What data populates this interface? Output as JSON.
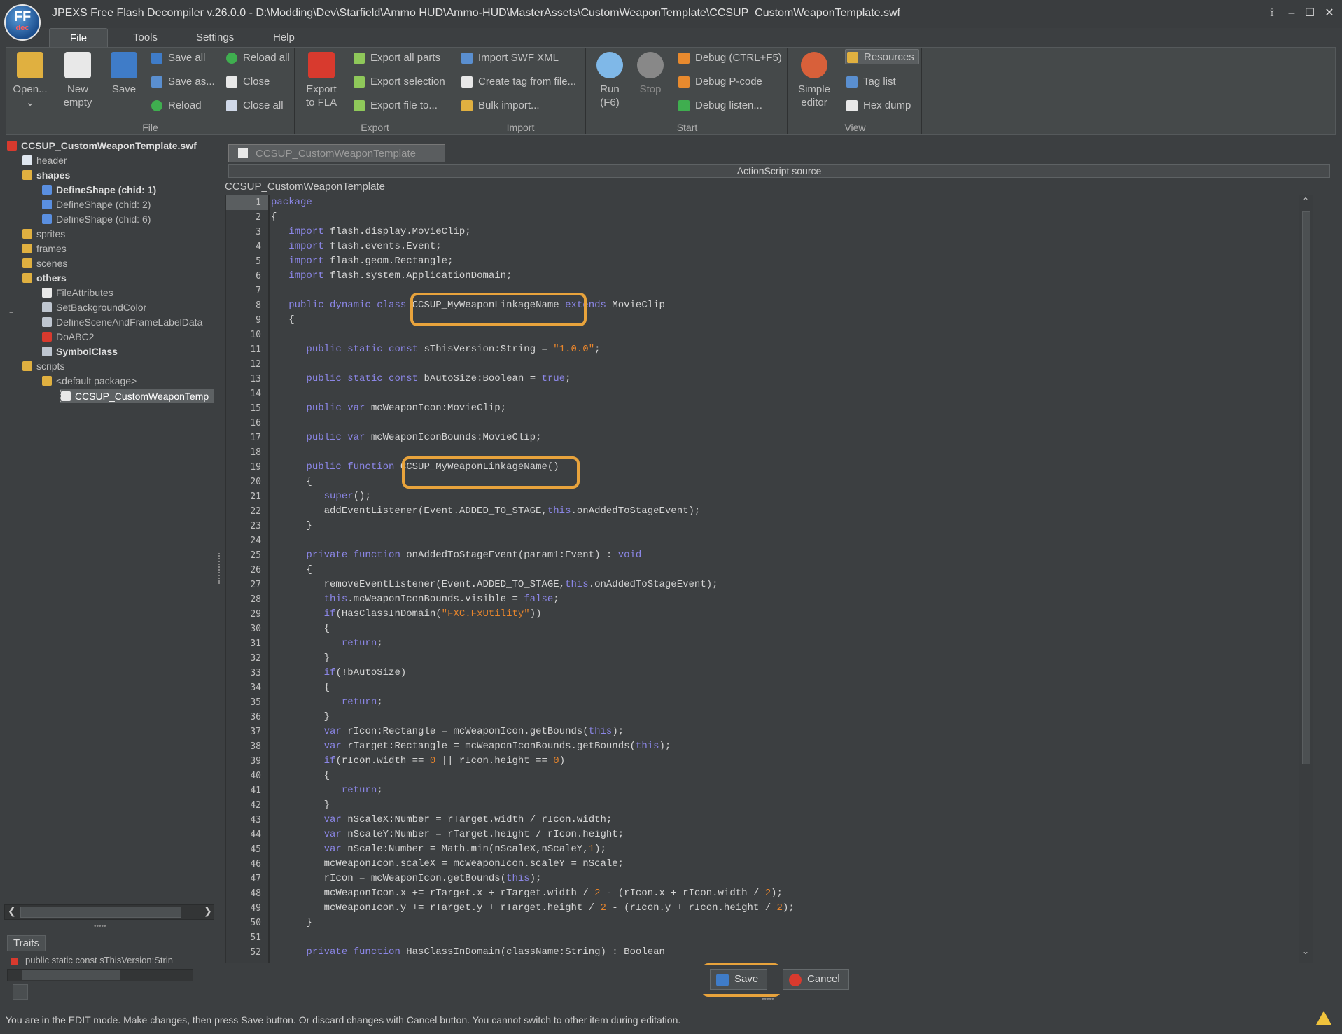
{
  "window": {
    "title": "JPEXS Free Flash Decompiler v.26.0.0 - D:\\Modding\\Dev\\Starfield\\Ammo HUD\\Ammo-HUD\\MasterAssets\\CustomWeaponTemplate\\CCSUP_CustomWeaponTemplate.swf",
    "logo_text": "FF",
    "logo_sub": "dec"
  },
  "menu": {
    "tabs": [
      "File",
      "Tools",
      "Settings",
      "Help"
    ]
  },
  "ribbon": {
    "file_group": {
      "label": "File",
      "open": "Open...",
      "new_line1": "New",
      "new_line2": "empty",
      "save": "Save",
      "save_all": "Save all",
      "save_as": "Save as...",
      "reload": "Reload",
      "reload_all": "Reload all",
      "close": "Close",
      "close_all": "Close all"
    },
    "export_group": {
      "label": "Export",
      "export_fla_line1": "Export",
      "export_fla_line2": "to FLA",
      "export_all": "Export all parts",
      "export_selection": "Export selection",
      "export_file": "Export file to..."
    },
    "import_group": {
      "label": "Import",
      "import_swf_xml": "Import SWF XML",
      "create_tag": "Create tag from file...",
      "bulk_import": "Bulk import..."
    },
    "start_group": {
      "label": "Start",
      "run_line1": "Run",
      "run_line2": "(F6)",
      "stop": "Stop",
      "debug": "Debug (CTRL+F5)",
      "debug_pcode": "Debug P-code",
      "debug_listen": "Debug listen..."
    },
    "view_group": {
      "label": "View",
      "simple_line1": "Simple",
      "simple_line2": "editor",
      "resources": "Resources",
      "tag_list": "Tag list",
      "hex_dump": "Hex dump"
    }
  },
  "tree": {
    "root": "CCSUP_CustomWeaponTemplate.swf",
    "items": [
      {
        "label": "header"
      },
      {
        "label": "shapes"
      },
      {
        "label": "DefineShape (chid: 1)"
      },
      {
        "label": "DefineShape (chid: 2)"
      },
      {
        "label": "DefineShape (chid: 6)"
      },
      {
        "label": "sprites"
      },
      {
        "label": "frames"
      },
      {
        "label": "scenes"
      },
      {
        "label": "others"
      },
      {
        "label": "FileAttributes"
      },
      {
        "label": "SetBackgroundColor"
      },
      {
        "label": "DefineSceneAndFrameLabelData"
      },
      {
        "label": "DoABC2"
      },
      {
        "label": "SymbolClass"
      },
      {
        "label": "scripts"
      },
      {
        "label": "<default package>"
      },
      {
        "label": "CCSUP_CustomWeaponTemp"
      }
    ]
  },
  "traits": {
    "tab": "Traits",
    "row": "public static const sThisVersion:Strin"
  },
  "editor": {
    "file_tab": "CCSUP_CustomWeaponTemplate",
    "panel_title": "ActionScript source",
    "class_label": "CCSUP_CustomWeaponTemplate",
    "line_numbers": [
      "1",
      "2",
      "3",
      "4",
      "5",
      "6",
      "7",
      "8",
      "9",
      "10",
      "11",
      "12",
      "13",
      "14",
      "15",
      "16",
      "17",
      "18",
      "19",
      "20",
      "21",
      "22",
      "23",
      "24",
      "25",
      "26",
      "27",
      "28",
      "29",
      "30",
      "31",
      "32",
      "33",
      "34",
      "35",
      "36",
      "37",
      "38",
      "39",
      "40",
      "41",
      "42",
      "43",
      "44",
      "45",
      "46",
      "47",
      "48",
      "49",
      "50",
      "51",
      "52"
    ]
  },
  "buttons": {
    "save": "Save",
    "cancel": "Cancel"
  },
  "status": {
    "message": "You are in the EDIT mode. Make changes, then press Save button. Or discard changes with Cancel button. You cannot switch to other item during editation."
  },
  "colors": {
    "accent_highlight": "#e8a33c",
    "keyword": "#8b86e6",
    "string": "#e8852c"
  }
}
